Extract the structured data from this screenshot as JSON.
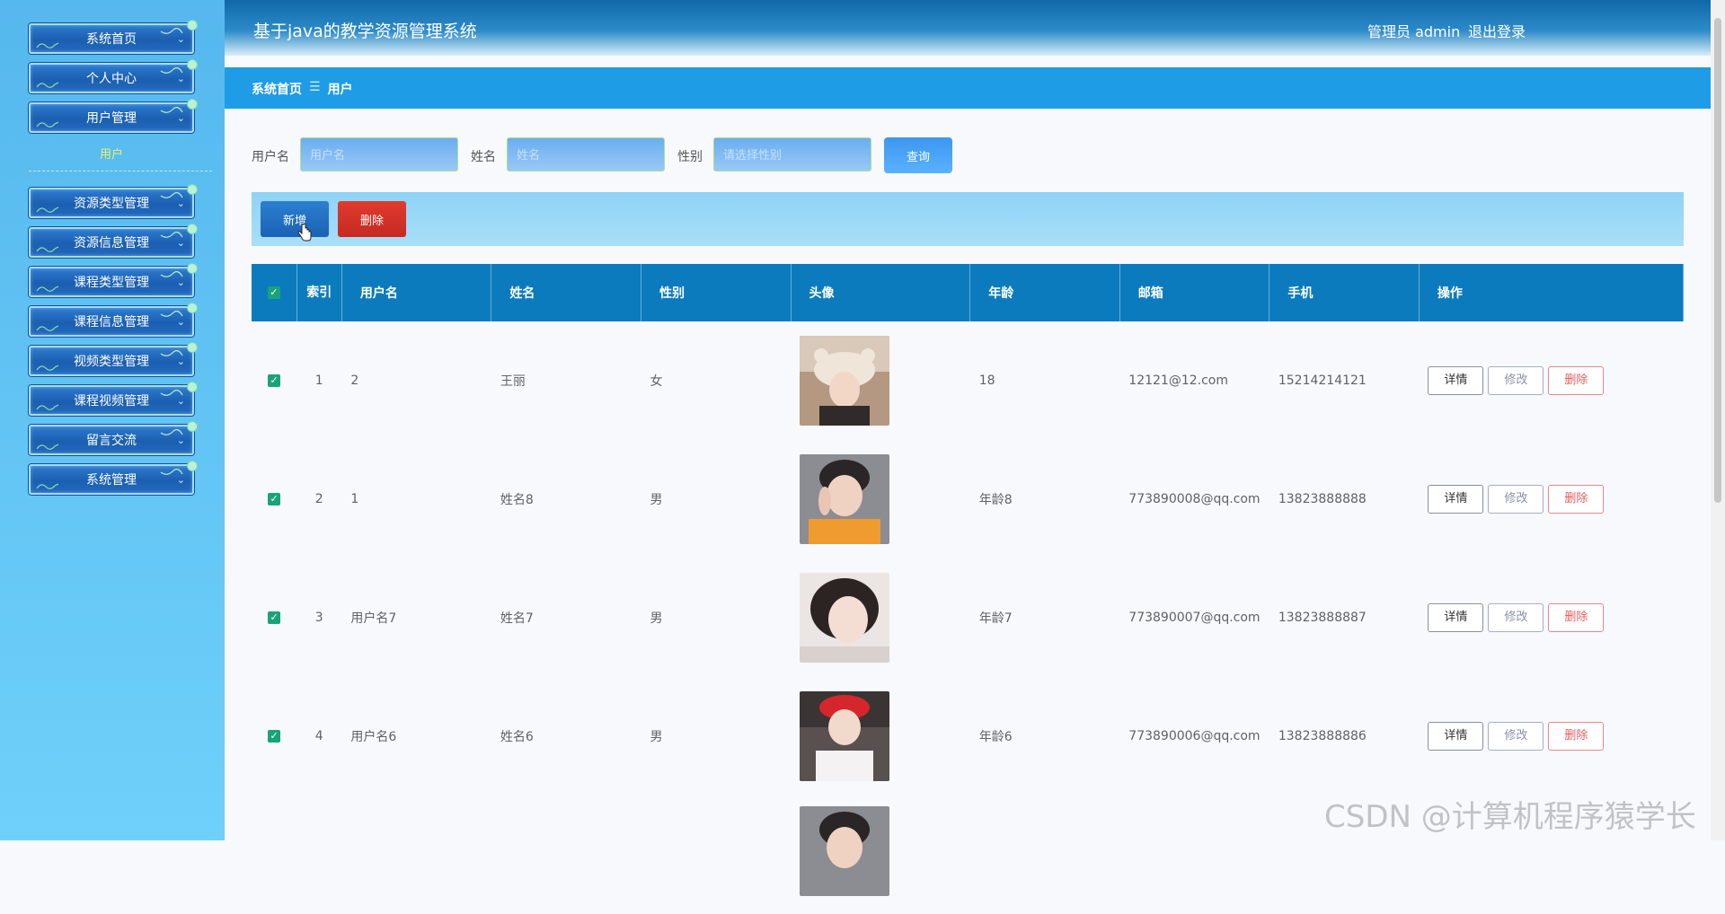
{
  "sidebar": {
    "items": [
      {
        "label": "系统首页"
      },
      {
        "label": "个人中心"
      },
      {
        "label": "用户管理"
      },
      {
        "label": "资源类型管理"
      },
      {
        "label": "资源信息管理"
      },
      {
        "label": "课程类型管理"
      },
      {
        "label": "课程信息管理"
      },
      {
        "label": "视频类型管理"
      },
      {
        "label": "课程视频管理"
      },
      {
        "label": "留言交流"
      },
      {
        "label": "系统管理"
      }
    ],
    "submenu_active": "用户"
  },
  "header": {
    "title": "基于java的教学资源管理系统",
    "user": "管理员 admin",
    "logout": "退出登录"
  },
  "breadcrumb": {
    "home": "系统首页",
    "sep": "☰",
    "current": "用户"
  },
  "search": {
    "username_label": "用户名",
    "username_placeholder": "用户名",
    "name_label": "姓名",
    "name_placeholder": "姓名",
    "gender_label": "性别",
    "gender_placeholder": "请选择性别",
    "query_button": "查询"
  },
  "actions": {
    "add": "新增",
    "delete": "删除"
  },
  "table": {
    "headers": {
      "check": "✓",
      "index": "索引",
      "username": "用户名",
      "name": "姓名",
      "gender": "性别",
      "avatar": "头像",
      "age": "年龄",
      "email": "邮箱",
      "phone": "手机",
      "ops": "操作"
    },
    "rows": [
      {
        "index": "1",
        "username": "2",
        "name": "王丽",
        "gender": "女",
        "age": "18",
        "email": "12121@12.com",
        "phone": "15214214121"
      },
      {
        "index": "2",
        "username": "1",
        "name": "姓名8",
        "gender": "男",
        "age": "年龄8",
        "email": "773890008@qq.com",
        "phone": "13823888888"
      },
      {
        "index": "3",
        "username": "用户名7",
        "name": "姓名7",
        "gender": "男",
        "age": "年龄7",
        "email": "773890007@qq.com",
        "phone": "13823888887"
      },
      {
        "index": "4",
        "username": "用户名6",
        "name": "姓名6",
        "gender": "男",
        "age": "年龄6",
        "email": "773890006@qq.com",
        "phone": "13823888886"
      }
    ],
    "op_labels": {
      "detail": "详情",
      "edit": "修改",
      "delete": "删除"
    }
  },
  "watermark": "CSDN @计算机程序猿学长",
  "colors": {
    "primary": "#0c7bbd",
    "breadcrumb": "#1e9ce6",
    "delete": "#d1342a",
    "check": "#1aa37a"
  }
}
